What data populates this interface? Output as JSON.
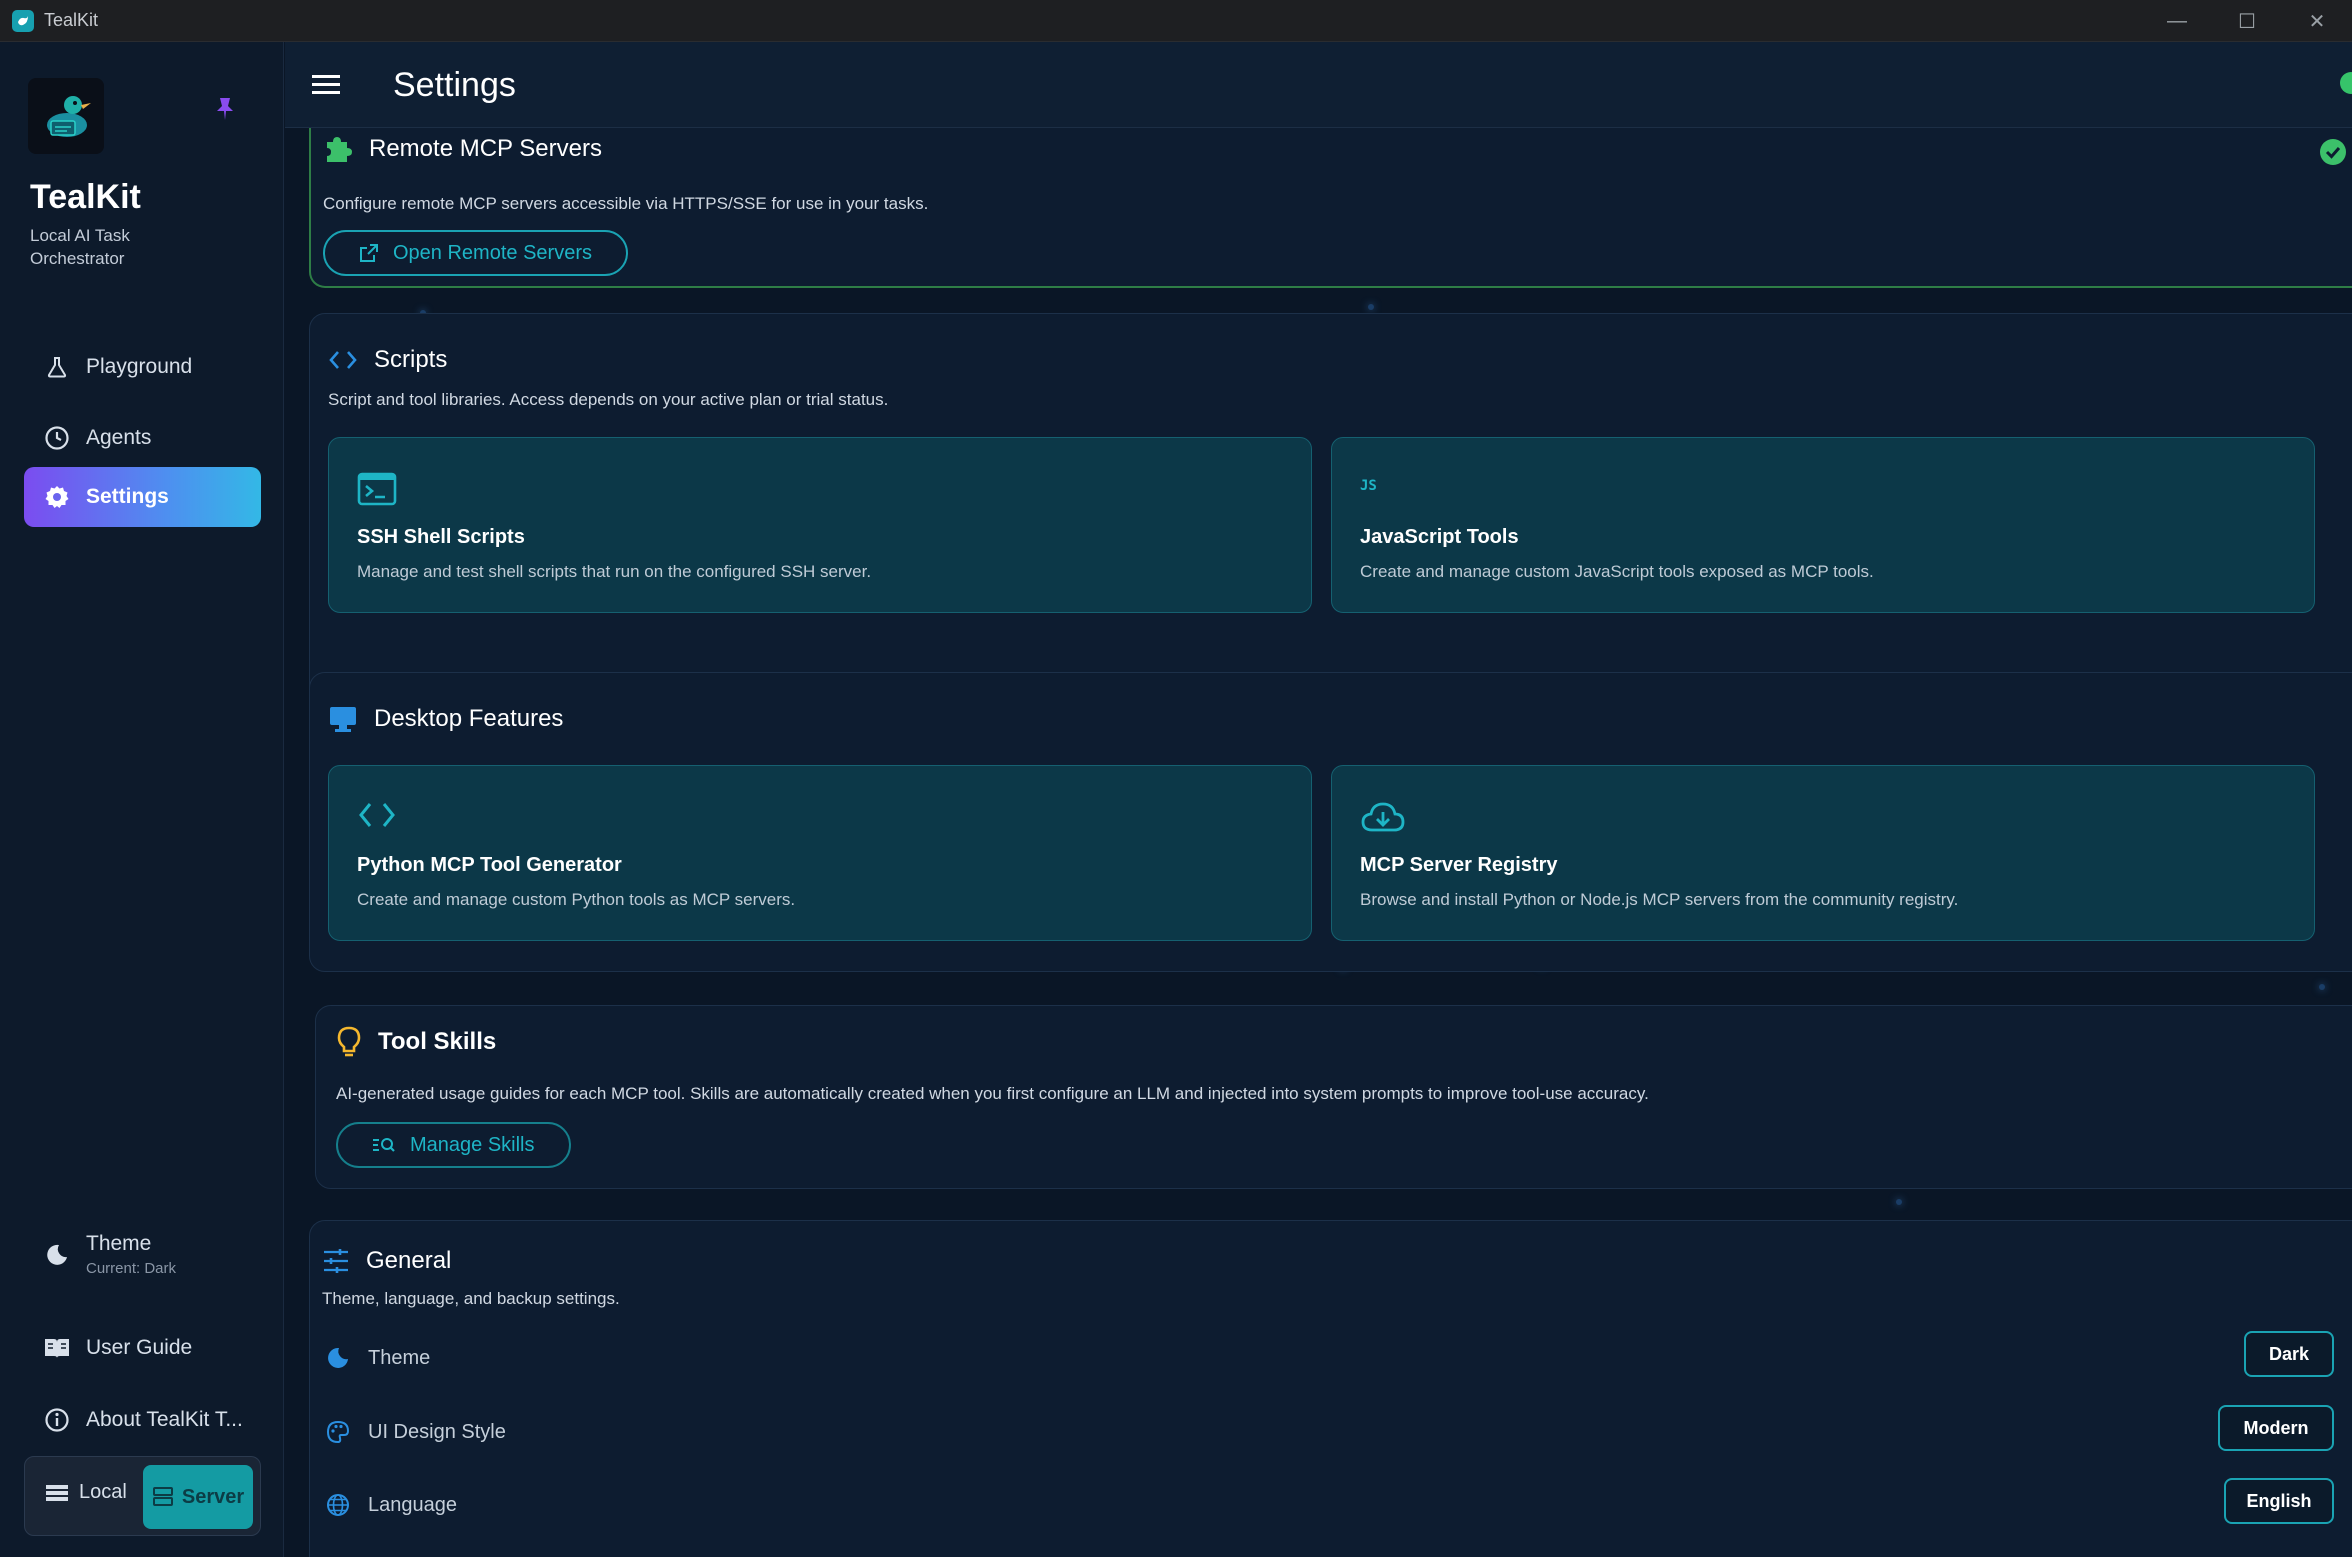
{
  "window": {
    "title": "TealKit"
  },
  "sidebar": {
    "brand_name": "TealKit",
    "brand_tagline": "Local AI Task Orchestrator",
    "nav": [
      {
        "label": "Playground",
        "icon": "flask-icon"
      },
      {
        "label": "Agents",
        "icon": "clock-icon"
      },
      {
        "label": "Settings",
        "icon": "gear-icon",
        "active": true
      }
    ],
    "theme_label": "Theme",
    "theme_current": "Current: Dark",
    "user_guide": "User Guide",
    "about": "About TealKit T...",
    "mode_local": "Local",
    "mode_server": "Server",
    "mode_active": "Server"
  },
  "header": {
    "title": "Settings"
  },
  "remote_mcp": {
    "title": "Remote MCP Servers",
    "description": "Configure remote MCP servers accessible via HTTPS/SSE for use in your tasks.",
    "button": "Open Remote Servers",
    "status": "enabled"
  },
  "scripts": {
    "title": "Scripts",
    "description": "Script and tool libraries. Access depends on your active plan or trial status.",
    "items": [
      {
        "title": "SSH Shell Scripts",
        "description": "Manage and test shell scripts that run on the configured SSH server.",
        "icon": "terminal-icon"
      },
      {
        "title": "JavaScript Tools",
        "description": "Create and manage custom JavaScript tools exposed as MCP tools.",
        "icon": "js-icon",
        "icon_text": "JS"
      }
    ]
  },
  "desktop": {
    "title": "Desktop Features",
    "items": [
      {
        "title": "Python MCP Tool Generator",
        "description": "Create and manage custom Python tools as MCP servers.",
        "icon": "code-icon"
      },
      {
        "title": "MCP Server Registry",
        "description": "Browse and install Python or Node.js MCP servers from the community registry.",
        "icon": "cloud-download-icon"
      }
    ]
  },
  "tool_skills": {
    "title": "Tool Skills",
    "description": "AI-generated usage guides for each MCP tool. Skills are automatically created when you first configure an LLM and injected into system prompts to improve tool-use accuracy.",
    "button": "Manage Skills"
  },
  "general": {
    "title": "General",
    "description": "Theme, language, and backup settings.",
    "rows": [
      {
        "label": "Theme",
        "value": "Dark",
        "icon": "moon-icon"
      },
      {
        "label": "UI Design Style",
        "value": "Modern",
        "icon": "palette-icon"
      },
      {
        "label": "Language",
        "value": "English",
        "icon": "globe-icon"
      }
    ]
  },
  "colors": {
    "accent": "#1aa3b3",
    "success": "#36c46a",
    "active_gradient_start": "#7b4cf0",
    "active_gradient_end": "#33b8e6"
  }
}
